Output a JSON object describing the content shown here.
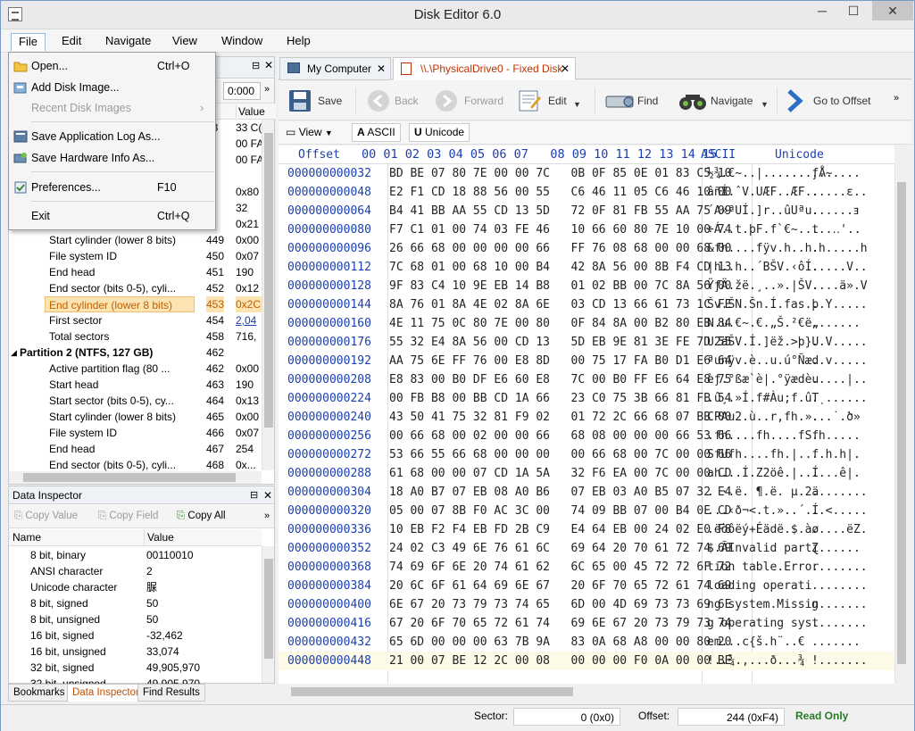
{
  "window": {
    "title": "Disk Editor 6.0",
    "minimize": "─",
    "maximize": "☐",
    "close": "✕"
  },
  "menubar": {
    "items": [
      "File",
      "Edit",
      "Navigate",
      "View",
      "Window",
      "Help"
    ]
  },
  "file_menu": {
    "items": [
      {
        "label": "Open...",
        "shortcut": "Ctrl+O",
        "icon": "folder-open-icon",
        "disabled": false
      },
      {
        "label": "Add Disk Image...",
        "shortcut": "",
        "icon": "disk-image-icon",
        "disabled": false
      },
      {
        "label": "Recent Disk Images",
        "shortcut": "",
        "icon": "",
        "disabled": true,
        "submenu": "›"
      },
      {
        "label": "Save Application Log As...",
        "shortcut": "",
        "icon": "log-icon",
        "disabled": false
      },
      {
        "label": "Save Hardware Info As...",
        "shortcut": "",
        "icon": "hardware-info-icon",
        "disabled": false
      },
      {
        "label": "Preferences...",
        "shortcut": "F10",
        "icon": "preferences-icon",
        "disabled": false
      },
      {
        "label": "Exit",
        "shortcut": "Ctrl+Q",
        "icon": "",
        "disabled": false
      }
    ]
  },
  "left_panel": {
    "offset_value": "0:000",
    "columns": {
      "offset": "t",
      "value": "Value"
    },
    "partial_rows": [
      {
        "o": "33",
        "v": "33 C("
      },
      {
        "o": "",
        "v": "00 FA"
      },
      {
        "o": "",
        "v": "00 FA"
      },
      {
        "o": "6",
        "v": ""
      },
      {
        "o": "",
        "v": "0x80"
      },
      {
        "o": "",
        "v": "32"
      },
      {
        "o": "",
        "v": "0x21"
      }
    ],
    "rows": [
      {
        "name": "Start cylinder (lower 8 bits)",
        "offset": "449",
        "value": "0x00"
      },
      {
        "name": "File system ID",
        "offset": "450",
        "value": "0x07"
      },
      {
        "name": "End head",
        "offset": "451",
        "value": "190"
      },
      {
        "name": "End sector (bits 0-5), cyli...",
        "offset": "452",
        "value": "0x12"
      },
      {
        "name": "End cylinder (lower 8 bits)",
        "offset": "453",
        "value": "0x2C",
        "selected": true
      },
      {
        "name": "First sector",
        "offset": "454",
        "value": "2,04"
      },
      {
        "name": "Total sectors",
        "offset": "458",
        "value": "716,"
      },
      {
        "name": "Partition 2 (NTFS, 127 GB)",
        "offset": "462",
        "value": "",
        "group": true
      },
      {
        "name": "Active partition flag (80 ...",
        "offset": "462",
        "value": "0x00"
      },
      {
        "name": "Start head",
        "offset": "463",
        "value": "190"
      },
      {
        "name": "Start sector (bits 0-5), cy...",
        "offset": "464",
        "value": "0x13"
      },
      {
        "name": "Start cylinder (lower 8 bits)",
        "offset": "465",
        "value": "0x00"
      },
      {
        "name": "File system ID",
        "offset": "466",
        "value": "0x07"
      },
      {
        "name": "End head",
        "offset": "467",
        "value": "254"
      },
      {
        "name": "End sector (bits 0-5), cyli...",
        "offset": "468",
        "value": "0x..."
      }
    ]
  },
  "data_inspector": {
    "title": "Data Inspector",
    "toolbar": {
      "copy_value": "Copy Value",
      "copy_field": "Copy Field",
      "copy_all": "Copy All"
    },
    "columns": {
      "name": "Name",
      "value": "Value"
    },
    "rows": [
      {
        "name": "8 bit, binary",
        "value": "00110010"
      },
      {
        "name": "ANSI character",
        "value": "2"
      },
      {
        "name": "Unicode character",
        "value": "脲"
      },
      {
        "name": "8 bit, signed",
        "value": "50"
      },
      {
        "name": "8 bit, unsigned",
        "value": "50"
      },
      {
        "name": "16 bit, signed",
        "value": "-32,462"
      },
      {
        "name": "16 bit, unsigned",
        "value": "33,074"
      },
      {
        "name": "32 bit, signed",
        "value": "49,905,970"
      },
      {
        "name": "32 bit, unsigned",
        "value": "49,905,970"
      }
    ]
  },
  "bottom_tabs": [
    "Bookmarks",
    "Data Inspector",
    "Find Results"
  ],
  "doc_tabs": [
    {
      "label": "My Computer",
      "close": "✕"
    },
    {
      "label": "\\\\.\\PhysicalDrive0 - Fixed Disk",
      "close": "✕"
    }
  ],
  "toolbar": {
    "save": "Save",
    "back": "Back",
    "forward": "Forward",
    "edit": "Edit",
    "find": "Find",
    "navigate": "Navigate",
    "go_to_offset": "Go to Offset",
    "more": "»"
  },
  "toolbar2": {
    "view": "View",
    "ascii": "ASCII",
    "unicode": "Unicode"
  },
  "hex_header": {
    "offset": "Offset",
    "columns": "00 01 02 03 04 05 06 07   08 09 10 11 12 13 14 15",
    "ascii": "ASCII",
    "unicode": "Unicode"
  },
  "hex_rows": [
    {
      "off": "000000000032",
      "hex": "BD BE 07 80 7E 00 00 7C   0B 0F 85 0E 01 83 C5 10",
      "ascii": "½¾.€~..|.......ƒÅ.",
      "uni": "..~...."
    },
    {
      "off": "000000000048",
      "hex": "E2 F1 CD 18 88 56 00 55   C6 46 11 05 C6 46 10 00",
      "ascii": "âñÍ.ˆV.UÆF..ÆF..",
      "uni": ".....ε.."
    },
    {
      "off": "000000000064",
      "hex": "B4 41 BB AA 55 CD 13 5D   72 0F 81 FB 55 AA 75 09",
      "ascii": "´A»ªUÍ.]r..ûUªu.",
      "uni": "......ⱻ"
    },
    {
      "off": "000000000080",
      "hex": "F7 C1 01 00 74 03 FE 46   10 66 60 80 7E 10 00 74",
      "ascii": "÷Á..t.þF.f`€~..t",
      "uni": "...‥'.."
    },
    {
      "off": "000000000096",
      "hex": "26 66 68 00 00 00 00 66   FF 76 08 68 00 00 68 00",
      "ascii": "&fh....fÿv.h..h.",
      "uni": ".h.....h"
    },
    {
      "off": "000000000112",
      "hex": "7C 68 01 00 68 10 00 B4   42 8A 56 00 8B F4 CD 13",
      "ascii": "|h..h..´BŠV.‹ôÍ.",
      "uni": ".....V.."
    },
    {
      "off": "000000000128",
      "hex": "9F 83 C4 10 9E EB 14 B8   01 02 BB 00 7C 8A 56 00",
      "ascii": "ŸƒÄ.žë.¸..».|ŠV.",
      "uni": "....ä».V"
    },
    {
      "off": "000000000144",
      "hex": "8A 76 01 8A 4E 02 8A 6E   03 CD 13 66 61 73 1C FE",
      "ascii": "Šv.ŠN.Šn.Í.fas.þ",
      "uni": "..Ү....."
    },
    {
      "off": "000000000160",
      "hex": "4E 11 75 0C 80 7E 00 80   0F 84 8A 00 B2 80 EB 84",
      "ascii": "N.u.€~.€.„Š.²€ë„",
      "uni": "......."
    },
    {
      "off": "000000000176",
      "hex": "55 32 E4 8A 56 00 CD 13   5D EB 9E 81 3E FE 7D 55",
      "ascii": "U2äŠV.Í.]ëž.>þ}U",
      "uni": "..V....."
    },
    {
      "off": "000000000192",
      "hex": "AA 75 6E FF 76 00 E8 8D   00 75 17 FA B0 D1 E6 64",
      "ascii": "ªunÿv.è..u.ú°Ñæd",
      "uni": "..v....."
    },
    {
      "off": "000000000208",
      "hex": "E8 83 00 B0 DF E6 60 E8   7C 00 B0 FF E6 64 E8 75",
      "ascii": "èƒ.°ßæ`è|.°ÿædèu",
      "uni": ".....|.."
    },
    {
      "off": "000000000224",
      "hex": "00 FB B8 00 BB CD 1A 66   23 C0 75 3B 66 81 FB 54",
      "ascii": ".û¸.»Í.f#Àu;f.ûT",
      "uni": ".ͺ......"
    },
    {
      "off": "000000000240",
      "hex": "43 50 41 75 32 81 F9 02   01 72 2C 66 68 07 BB 00",
      "ascii": "CPAu2.ù..r,fh.».",
      "uni": "...˙.ծ»"
    },
    {
      "off": "000000000256",
      "hex": "00 66 68 00 02 00 00 66   68 08 00 00 00 66 53 66",
      "ascii": ".fh....fh....fSf",
      "uni": ".h....."
    },
    {
      "off": "000000000272",
      "hex": "53 66 55 66 68 00 00 00   00 66 68 00 7C 00 00 66",
      "ascii": "SfUfh....fh.|..f",
      "uni": "..h.h|."
    },
    {
      "off": "000000000288",
      "hex": "61 68 00 00 07 CD 1A 5A   32 F6 EA 00 7C 00 00 CD",
      "ascii": "ah...Í.Z2öê.|..Í",
      "uni": "....ê|."
    },
    {
      "off": "000000000304",
      "hex": "18 A0 B7 07 EB 08 A0 B6   07 EB 03 A0 B5 07 32 E4",
      "ascii": ". ·.ë. ¶.ë. µ.2ä",
      "uni": "........"
    },
    {
      "off": "000000000320",
      "hex": "05 00 07 8B F0 AC 3C 00   74 09 BB 07 00 B4 0E CD",
      "ascii": "...‹ð¬<.t.»..´.Í",
      "uni": "..<....."
    },
    {
      "off": "000000000336",
      "hex": "10 EB F2 F4 EB FD 2B C9   E4 64 EB 00 24 02 E0 F8",
      "ascii": ".ëòôëý+Éädë.$.àø",
      "uni": ".....ëZ."
    },
    {
      "off": "000000000352",
      "hex": "24 02 C3 49 6E 76 61 6C   69 64 20 70 61 72 74 69",
      "ascii": "$.ÃInvalid parti",
      "uni": "Ɀ......"
    },
    {
      "off": "000000000368",
      "hex": "74 69 6F 6E 20 74 61 62   6C 65 00 45 72 72 6F 72",
      "ascii": "tion table.Error",
      "uni": "........"
    },
    {
      "off": "000000000384",
      "hex": "20 6C 6F 61 64 69 6E 67   20 6F 70 65 72 61 74 69",
      "ascii": " loading operati",
      "uni": "........"
    },
    {
      "off": "000000000400",
      "hex": "6E 67 20 73 79 73 74 65   6D 00 4D 69 73 73 69 6E",
      "ascii": "ng system.Missin",
      "uni": "g......."
    },
    {
      "off": "000000000416",
      "hex": "67 20 6F 70 65 72 61 74   69 6E 67 20 73 79 73 74",
      "ascii": "g operating syst",
      "uni": "........"
    },
    {
      "off": "000000000432",
      "hex": "65 6D 00 00 00 63 7B 9A   83 0A 68 A8 00 00 80 20",
      "ascii": "em...c{š.h¨..€ ",
      "uni": "......."
    },
    {
      "off": "000000000448",
      "hex": "21 00 07 BE 12 2C 00 08   00 00 00 F0 0A 00 00 BE",
      "ascii": "!..¾.,...ð...¾",
      "uni": "!......."
    }
  ],
  "status": {
    "sector_label": "Sector:",
    "sector_value": "0 (0x0)",
    "offset_label": "Offset:",
    "offset_value": "244 (0xF4)",
    "mode": "Read Only"
  }
}
